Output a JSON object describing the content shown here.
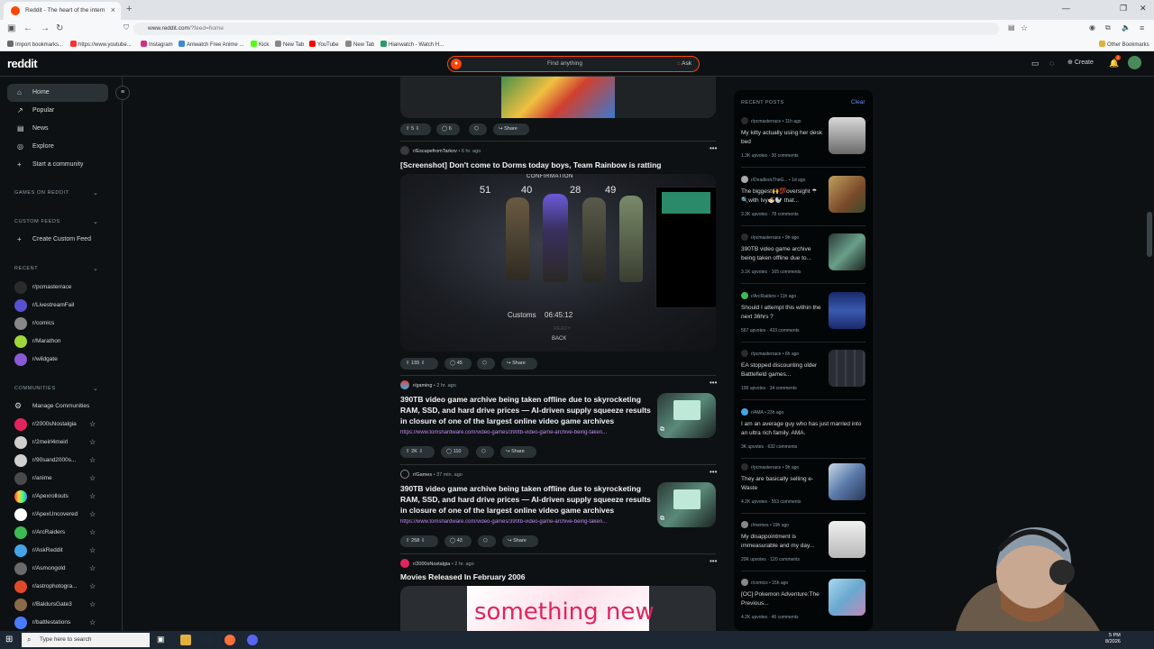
{
  "browser": {
    "tab_title": "Reddit - The heart of the intern",
    "tab_close": "×",
    "new_tab": "+",
    "url_host": "www.reddit.com",
    "url_path": "/?feed=home",
    "bookmarks": [
      "Import bookmarks...",
      "https://www.youtube...",
      "Instagram",
      "Aniwatch Free Anime ...",
      "Kick",
      "New Tab",
      "YouTube",
      "New Tab",
      "Hianwatch - Watch H..."
    ],
    "other_bookmarks": "Other Bookmarks"
  },
  "header": {
    "logo": "reddit",
    "search_placeholder": "Find anything",
    "ask_label": "Ask",
    "create_label": "Create",
    "notif_count": "1"
  },
  "sidebar": {
    "nav": [
      {
        "label": "Home",
        "icon": "home-icon"
      },
      {
        "label": "Popular",
        "icon": "popular-icon"
      },
      {
        "label": "News",
        "icon": "news-icon"
      },
      {
        "label": "Explore",
        "icon": "explore-icon"
      },
      {
        "label": "Start a community",
        "icon": "plus-icon"
      }
    ],
    "games_header": "GAMES ON REDDIT",
    "custom_feeds_header": "CUSTOM FEEDS",
    "create_custom_feed": "Create Custom Feed",
    "recent_header": "RECENT",
    "recent": [
      {
        "name": "r/pcmasterrace",
        "color": "#2b2b2b"
      },
      {
        "name": "r/LivestreamFail",
        "color": "#5a4fcf"
      },
      {
        "name": "r/comics",
        "color": "#888888"
      },
      {
        "name": "r/Marathon",
        "color": "#9fd63a"
      },
      {
        "name": "r/wildgate",
        "color": "#8a5ad6"
      }
    ],
    "communities_header": "COMMUNITIES",
    "manage_communities": "Manage Communities",
    "communities": [
      {
        "name": "r/2000sNostalgia",
        "color": "#e0245e"
      },
      {
        "name": "r/2meirl4meirl",
        "color": "#cfcfcf"
      },
      {
        "name": "r/90sand2000s...",
        "color": "#d0d0d0"
      },
      {
        "name": "r/anime",
        "color": "#4a4a4a"
      },
      {
        "name": "r/Apexrollouts",
        "color": "#ff6a3d"
      },
      {
        "name": "r/ApexUncovered",
        "color": "#ffffff"
      },
      {
        "name": "r/ArcRaiders",
        "color": "#3cba54"
      },
      {
        "name": "r/AskReddit",
        "color": "#46a3e8"
      },
      {
        "name": "r/Asmongold",
        "color": "#6a6a6a"
      },
      {
        "name": "r/astrophotogra...",
        "color": "#e04a2a"
      },
      {
        "name": "r/BaldursGate3",
        "color": "#8a6a4a"
      },
      {
        "name": "r/battlestations",
        "color": "#4a7aff"
      }
    ]
  },
  "feed": {
    "post0": {
      "upvotes": "5",
      "comments": "6",
      "share": "Share"
    },
    "post1": {
      "subreddit": "r/EscapefromTarkov",
      "age": "6 hr. ago",
      "title": "[Screenshot] Don't come to Dorms today boys, Team Rainbow is ratting",
      "img_header": "CONFIRMATION",
      "levels": [
        "51",
        "40",
        "28",
        "49"
      ],
      "map": "Customs",
      "time": "06:45:12",
      "ready": "READY",
      "back": "BACK",
      "upvotes": "155",
      "comments": "45",
      "share": "Share"
    },
    "post2": {
      "subreddit": "r/gaming",
      "age": "2 hr. ago",
      "title": "390TB video game archive being taken offline due to skyrocketing RAM, SSD, and hard drive prices — AI-driven supply squeeze results in closure of one of the largest online video game archives",
      "link": "https://www.tomshardware.com/video-games/390tb-video-game-archive-being-taken...",
      "upvotes": "2K",
      "comments": "110",
      "share": "Share"
    },
    "post3": {
      "subreddit": "r/Games",
      "age": "37 min. ago",
      "title": "390TB video game archive being taken offline due to skyrocketing RAM, SSD, and hard drive prices — AI-driven supply squeeze results in closure of one of the largest online video game archives",
      "link": "https://www.tomshardware.com/video-games/390tb-video-game-archive-being-taken...",
      "upvotes": "258",
      "comments": "43",
      "share": "Share"
    },
    "post4": {
      "subreddit": "r/2000sNostalgia",
      "age": "2 hr. ago",
      "title": "Movies Released In February 2006",
      "img_text": "something new"
    }
  },
  "recent_posts": {
    "header": "RECENT POSTS",
    "clear": "Clear",
    "items": [
      {
        "sub": "r/pcmasterrace",
        "age": "11h ago",
        "title": "My kitty actually using her desk bed",
        "upvotes": "1.3K upvotes",
        "comments": "30 comments",
        "thumb": "#8a8a8a"
      },
      {
        "sub": "r/DeadlockTheG...",
        "age": "1d ago",
        "title": "The biggest🙌💯oversight ☂🔍with Ivy🍜🦭 that...",
        "upvotes": "3.3K upvotes",
        "comments": "78 comments",
        "thumb": "#7a6a3a"
      },
      {
        "sub": "r/pcmasterrace",
        "age": "9h ago",
        "title": "390TB video game archive being taken offline due to...",
        "upvotes": "3.1K upvotes",
        "comments": "165 comments",
        "thumb": "#3a6a5a"
      },
      {
        "sub": "r/ArcRaiders",
        "age": "11h ago",
        "title": "Should I attempt this within the next 36hrs ?",
        "upvotes": "567 upvotes",
        "comments": "433 comments",
        "thumb": "#2a3a8a"
      },
      {
        "sub": "r/pcmasterrace",
        "age": "6h ago",
        "title": "EA stopped discounting older Battlefield games...",
        "upvotes": "109 upvotes",
        "comments": "34 comments",
        "thumb": "#2a2e34"
      },
      {
        "sub": "r/AMA",
        "age": "23h ago",
        "title": "I am an average guy who has just married into an ultra rich family. AMA.",
        "upvotes": "3K upvotes",
        "comments": "632 comments",
        "thumb": ""
      },
      {
        "sub": "r/pcmasterrace",
        "age": "9h ago",
        "title": "They are basically selling e-Waste",
        "upvotes": "4.2K upvotes",
        "comments": "553 comments",
        "thumb": "#5a7aaa"
      },
      {
        "sub": "r/memes",
        "age": "19h ago",
        "title": "My disappointment is immeasurable and my day...",
        "upvotes": "20K upvotes",
        "comments": "120 comments",
        "thumb": "#d8d8d8"
      },
      {
        "sub": "r/comics",
        "age": "15h ago",
        "title": "[OC] Pokemon Adventure:The Previous...",
        "upvotes": "4.2K upvotes",
        "comments": "46 comments",
        "thumb": "#7ab0d8"
      }
    ]
  },
  "taskbar": {
    "search_placeholder": "Type here to search",
    "time": "5 PM",
    "date": "8/2026"
  }
}
